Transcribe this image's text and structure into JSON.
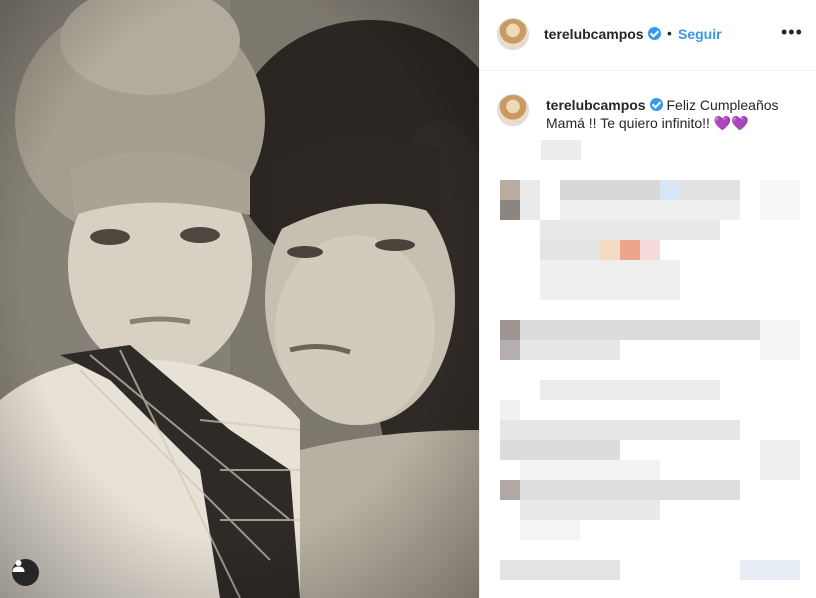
{
  "post": {
    "username": "terelubcampos",
    "separator": "•",
    "follow_label": "Seguir",
    "more_label": "•••",
    "caption_username": "terelubcampos",
    "caption_line1": "Feliz Cumpleaños",
    "caption_line2": "Mamá !! Te quiero infinito!!",
    "caption_emoji": "💜💜"
  },
  "icons": {
    "verified": "verified-badge-icon",
    "tag": "user-tag-icon",
    "more": "more-options-icon"
  },
  "colors": {
    "accent": "#3897f0",
    "text": "#262626",
    "border": "#efefef"
  }
}
